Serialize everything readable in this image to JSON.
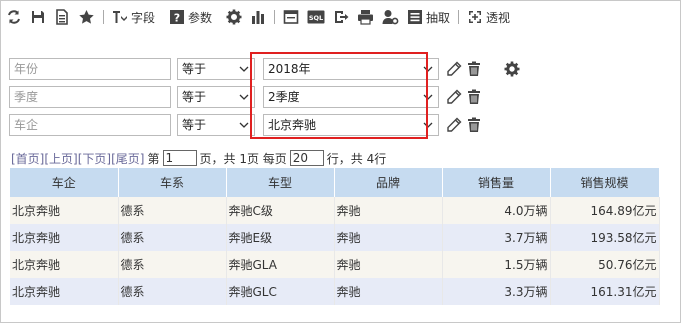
{
  "toolbar": {
    "field_label": "字段",
    "param_label": "参数",
    "extract_label": "抽取",
    "pivot_label": "透视",
    "sql_label": "SQL"
  },
  "filters": [
    {
      "field": "年份",
      "operator": "等于",
      "value": "2018年"
    },
    {
      "field": "季度",
      "operator": "等于",
      "value": "2季度"
    },
    {
      "field": "车企",
      "operator": "等于",
      "value": "北京奔驰"
    }
  ],
  "pager": {
    "first": "[首页]",
    "prev": "[上页]",
    "next": "[下页]",
    "last": "[尾页]",
    "page_prefix": "第",
    "page_value": "1",
    "page_suffix": "页，共 1页 每页",
    "size_value": "20",
    "size_suffix": "行，共 4行"
  },
  "table": {
    "headers": [
      "车企",
      "车系",
      "车型",
      "品牌",
      "销售量",
      "销售规模"
    ],
    "rows": [
      [
        "北京奔驰",
        "德系",
        "奔驰C级",
        "奔驰",
        "4.0万辆",
        "164.89亿元"
      ],
      [
        "北京奔驰",
        "德系",
        "奔驰E级",
        "奔驰",
        "3.7万辆",
        "193.58亿元"
      ],
      [
        "北京奔驰",
        "德系",
        "奔驰GLA",
        "奔驰",
        "1.5万辆",
        "50.76亿元"
      ],
      [
        "北京奔驰",
        "德系",
        "奔驰GLC",
        "奔驰",
        "3.3万辆",
        "161.31亿元"
      ]
    ]
  }
}
